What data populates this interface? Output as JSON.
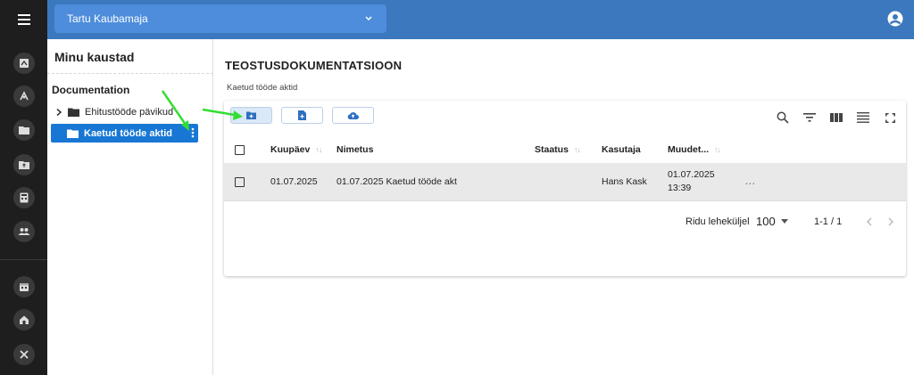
{
  "header": {
    "company": "Tartu Kaubamaja"
  },
  "tree": {
    "title": "Minu kaustad",
    "root": "Documentation",
    "items": [
      {
        "label": "Ehitustööde pävikud",
        "selected": false
      },
      {
        "label": "Kaetud tööde aktid",
        "selected": true
      }
    ]
  },
  "main": {
    "title": "TEOSTUSDOKUMENTATSIOON",
    "breadcrumb": "Kaetud tööde aktid"
  },
  "table": {
    "columns": {
      "date": "Kuupäev",
      "name": "Nimetus",
      "status": "Staatus",
      "user": "Kasutaja",
      "modified": "Muudet..."
    },
    "rows": [
      {
        "date": "01.07.2025",
        "name": "01.07.2025 Kaetud tööde akt",
        "status": "",
        "user": "Hans Kask",
        "modified_date": "01.07.2025",
        "modified_time": "13:39",
        "actions": "..."
      }
    ],
    "footer": {
      "rows_per_page_label": "Ridu leheküljel",
      "rows_per_page_value": "100",
      "range": "1-1 / 1"
    }
  },
  "colors": {
    "header": "#3c78bd",
    "selected": "#1877d4",
    "rail": "#1e1e1e",
    "arrow": "#33dd33"
  },
  "icons": {
    "rail": [
      "menu-icon",
      "dashboard-icon",
      "tools-icon",
      "folder-icon",
      "folder-upload-icon",
      "calculator-icon",
      "users-icon",
      "calendar-icon",
      "home-icon",
      "settings-tools-icon"
    ]
  }
}
